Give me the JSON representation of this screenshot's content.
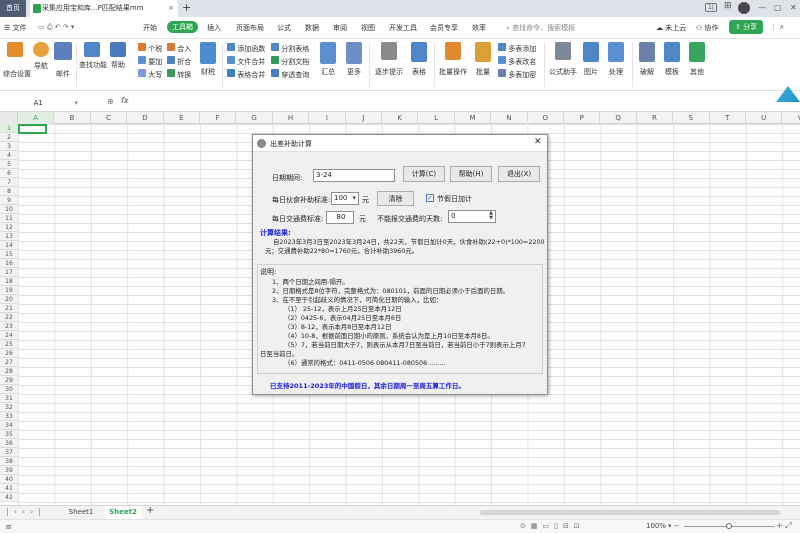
{
  "tabs": {
    "home": "首页",
    "doc": "采集应用宝和库...P匹配结果mm",
    "new_tab": "+"
  },
  "menu": [
    "开始",
    "工具箱",
    "插入",
    "页面布局",
    "公式",
    "数据",
    "审阅",
    "视图",
    "开发工具",
    "会员专享",
    "效率"
  ],
  "menu_search": "查找命令、搜索模板",
  "menu_right": {
    "cloud": "未上云",
    "collab": "协作",
    "share": "分享"
  },
  "ribbon": {
    "b1": "综合设置",
    "b2": "导航",
    "b3": "邮件",
    "b4": "查找功能",
    "b5": "帮助",
    "s1": [
      "个税",
      "要加",
      "大写"
    ],
    "s2": [
      "合入",
      "折合",
      "转换"
    ],
    "b6": "财税",
    "s3": [
      "添加函数",
      "文件合并",
      "表格合并"
    ],
    "s4": [
      "分割表格",
      "分割文档",
      "穿透查询"
    ],
    "b7": "汇总",
    "b8": "更多",
    "b9": "逐步提示",
    "b10": "表格",
    "b11": "批量操作",
    "b12": "批量",
    "s5": [
      "多表添加",
      "多表改名",
      "多表加密"
    ],
    "b13": "公式助手",
    "b14": "图片",
    "b15": "处理",
    "b16": "破解",
    "b17": "模板",
    "b18": "其他"
  },
  "formula": {
    "cellref": "A1",
    "fx": "fx"
  },
  "columns": [
    "A",
    "B",
    "C",
    "D",
    "E",
    "F",
    "G",
    "H",
    "I",
    "J",
    "K",
    "L",
    "M",
    "N",
    "O",
    "P",
    "Q",
    "R",
    "S",
    "T",
    "U",
    "V"
  ],
  "rows": [
    "1",
    "2",
    "3",
    "4",
    "5",
    "6",
    "7",
    "8",
    "9",
    "10",
    "11",
    "12",
    "13",
    "14",
    "15",
    "16",
    "17",
    "18",
    "19",
    "20",
    "21",
    "22",
    "23",
    "24",
    "25",
    "26",
    "27",
    "28",
    "29",
    "30",
    "31",
    "32",
    "33",
    "34",
    "35",
    "36",
    "37",
    "38",
    "39",
    "40",
    "41",
    "42"
  ],
  "sheets": [
    "Sheet1",
    "Sheet2"
  ],
  "status": {
    "zoom": "100%"
  },
  "dialog": {
    "title": "出差补助计算",
    "date_label": "日期期间:",
    "date_value": "3-24",
    "calc_btn": "计算(C)",
    "help_btn": "帮助(H)",
    "exit_btn": "退出(X)",
    "meal_label": "每日伙食补助标准:",
    "meal_value": "100",
    "meal_unit": "元",
    "clear_btn": "清除",
    "holiday_label": "节假日加计",
    "transport_label": "每日交通费标准:",
    "transport_value": "80",
    "transport_unit": "元",
    "days_label": "不能报交通费的天数:",
    "days_value": "0",
    "result_title": "计算结果:",
    "result_line1": "自2023年3月3日至2023年3月24日，共22天，节假日加计0天，伙食补助(22+0)*100=2200",
    "result_line2": "元；交通费补助22*80=1760元，合计补助3960元。",
    "notes_title": "说明:",
    "notes": [
      "1、两个日期之间用-隔开。",
      "2、日期格式是8位字符，完整格式为：080101，前面的日期必须小于后面的日期。",
      "3、在不至于引起歧义的情况下，可简化日期的输入，比如：",
      "（1） 25-12，表示上月25日至本月12日",
      "（2）0425-6，表示04月25日至本月6日",
      "（3）8-12，表示本月8日至本月12日",
      "（4）10-8，根据前面日期小的原则，系统会认为是上月10日至本月8日。",
      "（5）7，若当前日期大于7，则表示从本月7日至当前日，若当前日小于7则表示上月7",
      "日至当前日。",
      "（6）通常的格式：0411-0506   080411-080506  ........"
    ],
    "footer": "已支持2011-2023年的中国假日，其余日期周一至周五算工作日。"
  }
}
